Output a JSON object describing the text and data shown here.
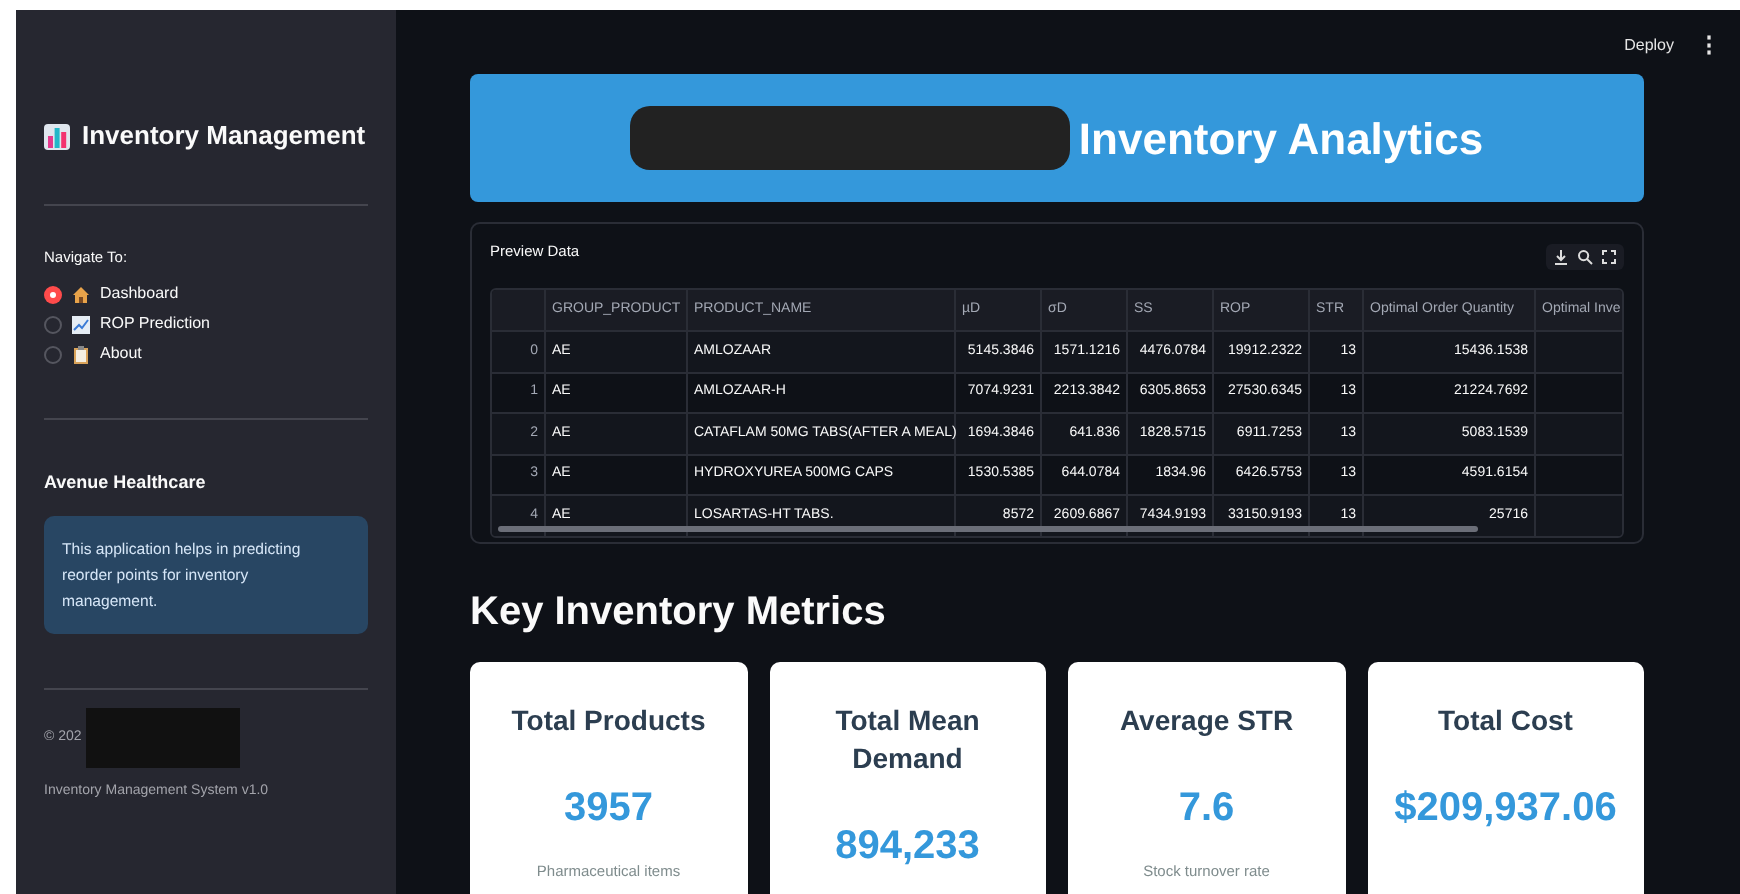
{
  "header": {
    "deploy": "Deploy",
    "menu": "⋮"
  },
  "sidebar": {
    "title": "Inventory Management",
    "nav_label": "Navigate To:",
    "nav_items": [
      {
        "label": "Dashboard",
        "selected": true
      },
      {
        "label": "ROP Prediction",
        "selected": false
      },
      {
        "label": "About",
        "selected": false
      }
    ],
    "company": "Avenue Healthcare",
    "info": "This application helps in predicting reorder points for inventory management.",
    "copyright": "© 202",
    "version": "Inventory Management System v1.0"
  },
  "banner": {
    "title": "Inventory Analytics"
  },
  "preview": {
    "title": "Preview Data",
    "columns": [
      "",
      "GROUP_PRODUCT",
      "PRODUCT_NAME",
      "µD",
      "σD",
      "SS",
      "ROP",
      "STR",
      "Optimal Order Quantity",
      "Optimal Inve"
    ],
    "rows": [
      [
        "0",
        "AE",
        "AMLOZAAR",
        "5145.3846",
        "1571.1216",
        "4476.0784",
        "19912.2322",
        "13",
        "15436.1538",
        ""
      ],
      [
        "1",
        "AE",
        "AMLOZAAR-H",
        "7074.9231",
        "2213.3842",
        "6305.8653",
        "27530.6345",
        "13",
        "21224.7692",
        ""
      ],
      [
        "2",
        "AE",
        "CATAFLAM 50MG TABS(AFTER A MEAL)",
        "1694.3846",
        "641.836",
        "1828.5715",
        "6911.7253",
        "13",
        "5083.1539",
        ""
      ],
      [
        "3",
        "AE",
        "HYDROXYUREA 500MG CAPS",
        "1530.5385",
        "644.0784",
        "1834.96",
        "6426.5753",
        "13",
        "4591.6154",
        ""
      ],
      [
        "4",
        "AE",
        "LOSARTAS-HT TABS.",
        "8572",
        "2609.6867",
        "7434.9193",
        "33150.9193",
        "13",
        "25716",
        ""
      ]
    ]
  },
  "metrics_title": "Key Inventory Metrics",
  "metrics": [
    {
      "title": "Total Products",
      "value": "3957",
      "caption": "Pharmaceutical items"
    },
    {
      "title": "Total Mean Demand",
      "value": "894,233"
    },
    {
      "title": "Average STR",
      "value": "7.6",
      "caption": "Stock turnover rate"
    },
    {
      "title": "Total Cost",
      "value": "$209,937.06"
    }
  ]
}
